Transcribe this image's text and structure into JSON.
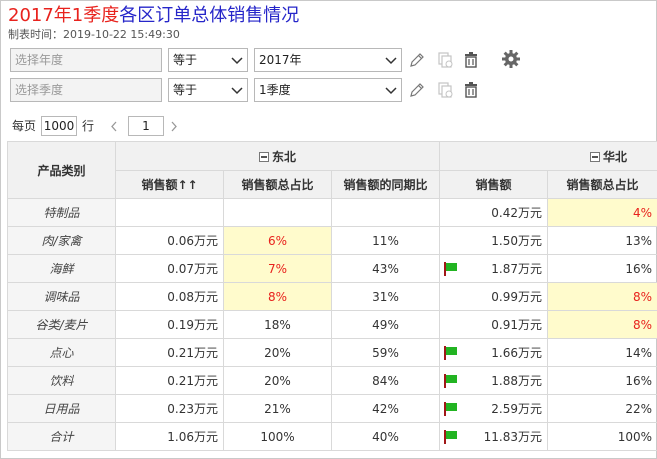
{
  "title": {
    "part_red": "2017年1季度",
    "part_blue": "各区订单总体销售情况"
  },
  "subtitle": "制表时间：2019-10-22 15:49:30",
  "filters": [
    {
      "label_placeholder": "选择年度",
      "operator": "等于",
      "value": "2017年"
    },
    {
      "label_placeholder": "选择季度",
      "operator": "等于",
      "value": "1季度"
    }
  ],
  "pager": {
    "per_page_label": "每页",
    "per_page_value": "1000",
    "row_unit": "行",
    "page_value": "1"
  },
  "table": {
    "corner_header": "产品类别",
    "groups": [
      {
        "name": "东北"
      },
      {
        "name": "华北"
      }
    ],
    "columns": {
      "db_sales": "销售额",
      "db_sort_glyph": "↑↑",
      "db_share": "销售额总占比",
      "db_yoy": "销售额的同期比",
      "hb_sales": "销售额",
      "hb_share": "销售额总占比"
    },
    "rows": [
      {
        "cat": "特制品",
        "db_sales": "",
        "db_share": "",
        "db_yoy": "",
        "hb_sales": "0.42万元",
        "hb_share": "4%",
        "db_share_hl": false,
        "hb_share_hl": true,
        "flag": false
      },
      {
        "cat": "肉/家禽",
        "db_sales": "0.06万元",
        "db_share": "6%",
        "db_yoy": "11%",
        "hb_sales": "1.50万元",
        "hb_share": "13%",
        "db_share_hl": true,
        "hb_share_hl": false,
        "flag": false
      },
      {
        "cat": "海鲜",
        "db_sales": "0.07万元",
        "db_share": "7%",
        "db_yoy": "43%",
        "hb_sales": "1.87万元",
        "hb_share": "16%",
        "db_share_hl": true,
        "hb_share_hl": false,
        "flag": true
      },
      {
        "cat": "调味品",
        "db_sales": "0.08万元",
        "db_share": "8%",
        "db_yoy": "31%",
        "hb_sales": "0.99万元",
        "hb_share": "8%",
        "db_share_hl": true,
        "hb_share_hl": true,
        "flag": false
      },
      {
        "cat": "谷类/麦片",
        "db_sales": "0.19万元",
        "db_share": "18%",
        "db_yoy": "49%",
        "hb_sales": "0.91万元",
        "hb_share": "8%",
        "db_share_hl": false,
        "hb_share_hl": true,
        "flag": false
      },
      {
        "cat": "点心",
        "db_sales": "0.21万元",
        "db_share": "20%",
        "db_yoy": "59%",
        "hb_sales": "1.66万元",
        "hb_share": "14%",
        "db_share_hl": false,
        "hb_share_hl": false,
        "flag": true
      },
      {
        "cat": "饮料",
        "db_sales": "0.21万元",
        "db_share": "20%",
        "db_yoy": "84%",
        "hb_sales": "1.88万元",
        "hb_share": "16%",
        "db_share_hl": false,
        "hb_share_hl": false,
        "flag": true
      },
      {
        "cat": "日用品",
        "db_sales": "0.23万元",
        "db_share": "21%",
        "db_yoy": "42%",
        "hb_sales": "2.59万元",
        "hb_share": "22%",
        "db_share_hl": false,
        "hb_share_hl": false,
        "flag": true
      },
      {
        "cat": "合计",
        "db_sales": "1.06万元",
        "db_share": "100%",
        "db_yoy": "40%",
        "hb_sales": "11.83万元",
        "hb_share": "100%",
        "db_share_hl": false,
        "hb_share_hl": false,
        "flag": true
      }
    ]
  },
  "colors": {
    "title_red": "#e8221d",
    "title_blue": "#2626c9",
    "highlight_bg": "#fffbcc",
    "highlight_text": "#e8221d",
    "flag_green": "#22b422",
    "flag_pole": "#a01818"
  },
  "icons": {
    "edit": "pencil-icon",
    "copy": "copy-icon",
    "delete": "trash-icon",
    "settings": "gear-icon",
    "flag": "flag-icon"
  }
}
